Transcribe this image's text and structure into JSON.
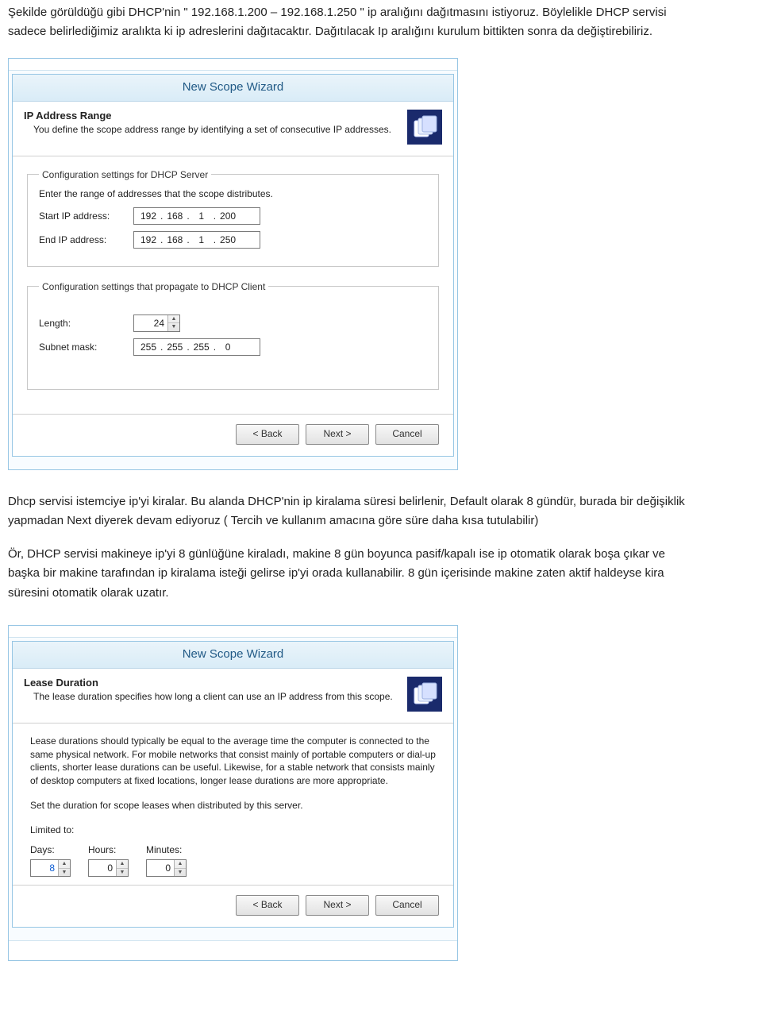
{
  "para1": {
    "l1": "Şekilde görüldüğü gibi  DHCP'nin \" 192.168.1.200 – 192.168.1.250 \" ip aralığını dağıtmasını istiyoruz. Böylelikle DHCP servisi",
    "l2": "sadece belirlediğimiz aralıkta ki ip adreslerini dağıtacaktır. Dağıtılacak Ip aralığını kurulum bittikten sonra da değiştirebiliriz."
  },
  "wizard1": {
    "window_title": "New Scope Wizard",
    "header_title": "IP Address Range",
    "header_subtitle": "You define the scope address range by identifying a set of consecutive IP addresses.",
    "group1_legend": "Configuration settings for DHCP Server",
    "group1_intro": "Enter the range of addresses that the scope distributes.",
    "start_label": "Start IP address:",
    "start_ip": [
      "192",
      "168",
      "1",
      "200"
    ],
    "end_label": "End IP address:",
    "end_ip": [
      "192",
      "168",
      "1",
      "250"
    ],
    "group2_legend": "Configuration settings that propagate to DHCP Client",
    "length_label": "Length:",
    "length_value": "24",
    "mask_label": "Subnet mask:",
    "mask": [
      "255",
      "255",
      "255",
      "0"
    ],
    "btn_back": "< Back",
    "btn_next": "Next >",
    "btn_cancel": "Cancel"
  },
  "para2": {
    "l1": "Dhcp servisi istemciye ip'yi kiralar. Bu alanda DHCP'nin ip kiralama süresi belirlenir, Default olarak 8 gündür, burada bir değişiklik",
    "l2": "yapmadan Next diyerek devam ediyoruz ( Tercih ve kullanım amacına göre süre daha kısa tutulabilir)"
  },
  "para3": {
    "l1": " Ör, DHCP servisi makineye ip'yi 8 günlüğüne kiraladı, makine 8 gün boyunca pasif/kapalı ise ip otomatik olarak boşa çıkar ve",
    "l2": "başka bir makine tarafından ip kiralama isteği gelirse ip'yi orada kullanabilir. 8 gün içerisinde makine zaten aktif haldeyse kira",
    "l3": "süresini otomatik olarak uzatır."
  },
  "wizard2": {
    "window_title": "New Scope Wizard",
    "header_title": "Lease Duration",
    "header_subtitle": "The lease duration specifies how long a client can use an IP address from this scope.",
    "body_p1": "Lease durations should typically be equal to the average time the computer is connected to the same physical network. For mobile networks that consist mainly of portable computers or dial-up clients, shorter lease durations can be useful. Likewise, for a stable network that consists mainly of desktop computers at fixed locations, longer lease durations are more appropriate.",
    "body_p2": "Set the duration for scope leases when distributed by this server.",
    "limited_to_label": "Limited to:",
    "days_label": "Days:",
    "hours_label": "Hours:",
    "minutes_label": "Minutes:",
    "days_value": "8",
    "hours_value": "0",
    "minutes_value": "0",
    "btn_back": "< Back",
    "btn_next": "Next >",
    "btn_cancel": "Cancel"
  }
}
